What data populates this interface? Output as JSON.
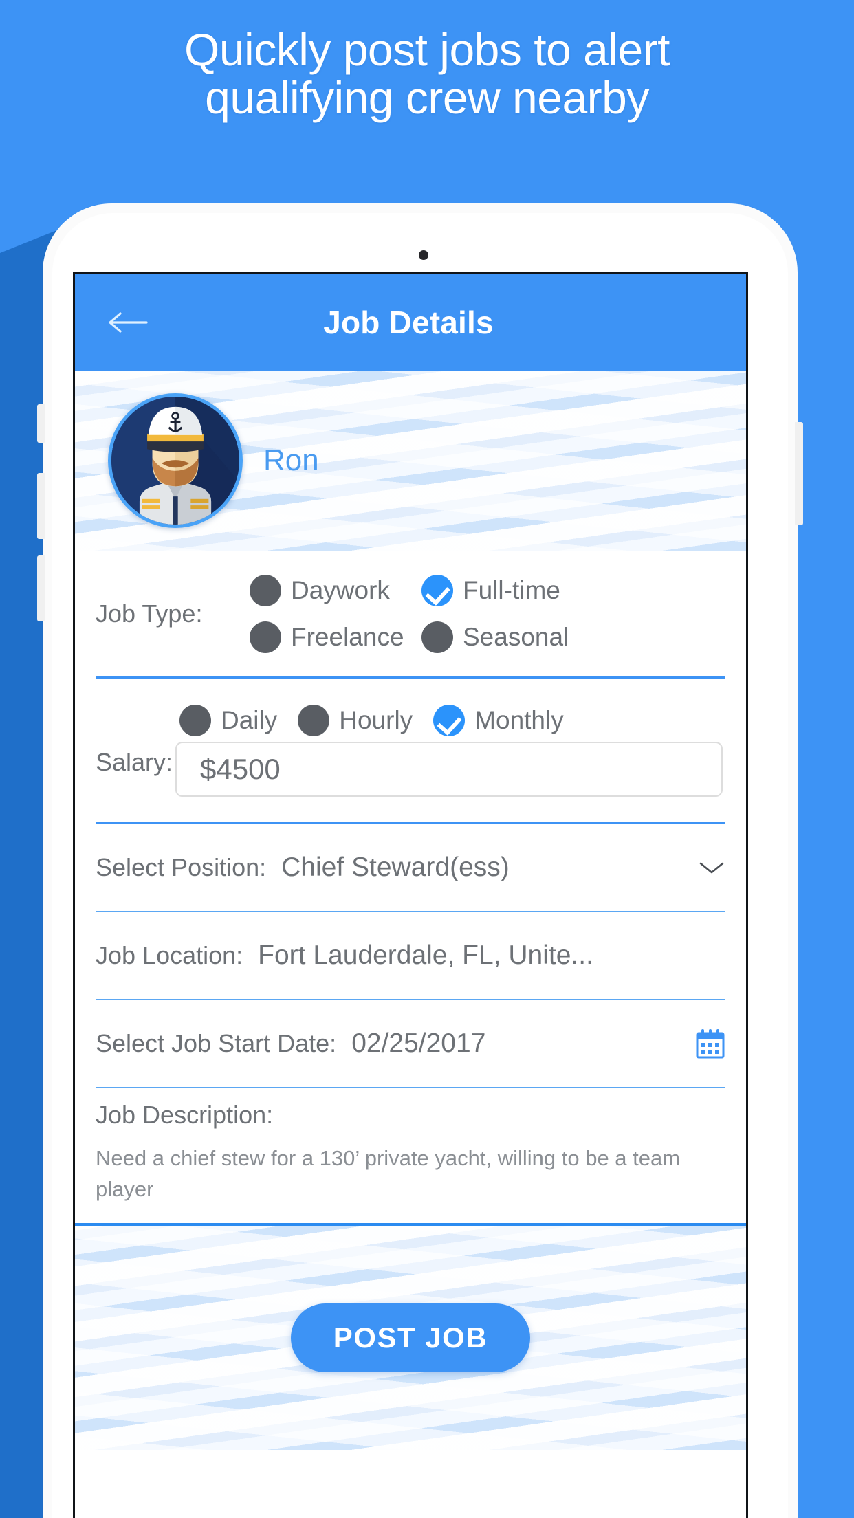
{
  "promo": {
    "headline_line1": "Quickly post jobs to alert",
    "headline_line2": "qualifying crew nearby",
    "background_color": "#3d93f5"
  },
  "appbar": {
    "title": "Job Details",
    "back_icon": "back-arrow-icon",
    "color": "#3d93f5"
  },
  "profile": {
    "name": "Ron",
    "avatar_icon": "captain-avatar"
  },
  "form": {
    "job_type": {
      "label": "Job Type:",
      "options": [
        {
          "label": "Daywork",
          "selected": false
        },
        {
          "label": "Full-time",
          "selected": true
        },
        {
          "label": "Freelance",
          "selected": false
        },
        {
          "label": "Seasonal",
          "selected": false
        }
      ]
    },
    "salary": {
      "label": "Salary:",
      "options": [
        {
          "label": "Daily",
          "selected": false
        },
        {
          "label": "Hourly",
          "selected": false
        },
        {
          "label": "Monthly",
          "selected": true
        }
      ],
      "value": "$4500",
      "placeholder": "$4500"
    },
    "position": {
      "label": "Select Position:",
      "value": "Chief Steward(ess)",
      "icon": "chevron-down-icon"
    },
    "location": {
      "label": "Job Location:",
      "value": "Fort Lauderdale, FL, Unite..."
    },
    "start_date": {
      "label": "Select Job Start Date:",
      "value": "02/25/2017",
      "icon": "calendar-icon"
    },
    "description": {
      "label": "Job Description:",
      "value": "Need a chief stew for a 130’ private yacht, willing to be a team player"
    }
  },
  "footer": {
    "post_label": "POST JOB"
  },
  "colors": {
    "accent": "#3d93f5",
    "radio_unselected": "#595d63",
    "radio_selected": "#2b93fb",
    "text": "#6d7176"
  }
}
